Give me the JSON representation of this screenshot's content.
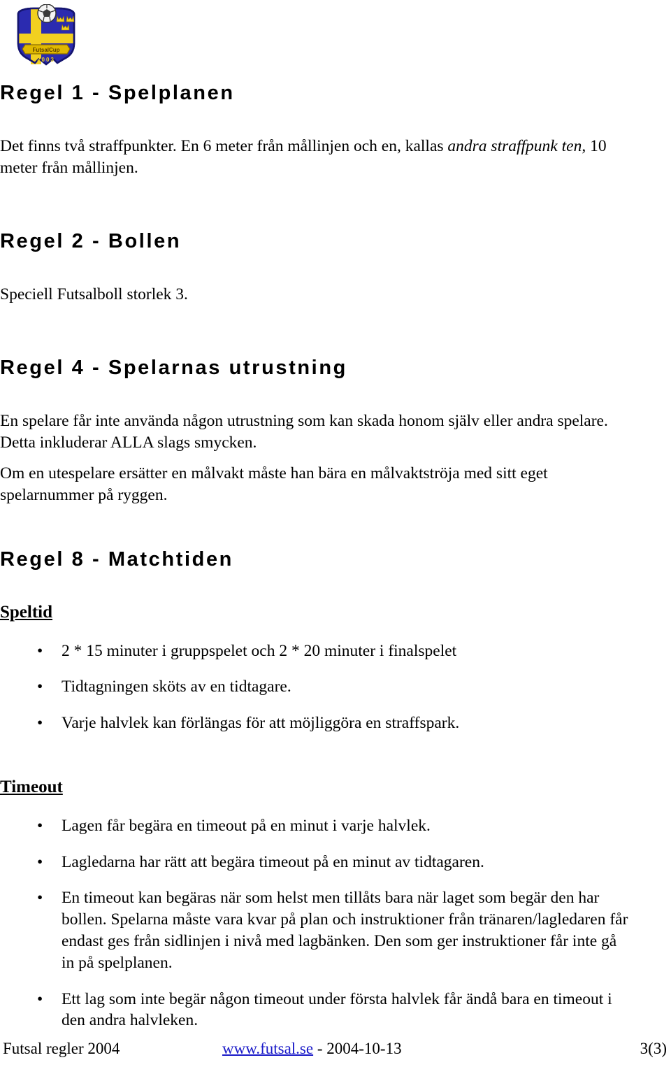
{
  "logo": {
    "name": "futsal-cup-shield-logo",
    "alt_text": "Futsal Cup 2003 shield emblem",
    "banner_text": "FutsalCup",
    "year_text": "2003",
    "colors": {
      "shield_blue": "#2b2bb0",
      "flag_yellow": "#f2d020",
      "outline_dark": "#1b1b6b",
      "ball_white": "#f2f2f2",
      "ball_dark": "#3a3a3a"
    }
  },
  "sections": [
    {
      "heading": "Regel 1 - Spelplanen",
      "paragraphs": [
        {
          "before": "Det finns två straffpunkter. En 6 meter från mållinjen och en, kallas ",
          "italic": "andra straffpunk ten",
          "after": ", 10 meter från mållinjen."
        }
      ]
    },
    {
      "heading": "Regel 2 - Bollen",
      "paragraphs": [
        {
          "text": "Speciell Futsalboll storlek 3."
        }
      ]
    },
    {
      "heading": "Regel 4 - Spelarnas utrustning",
      "paragraphs": [
        {
          "text": "En spelare får inte använda någon utrustning som kan skada honom själv eller andra spelare. Detta inkluderar ALLA slags smycken."
        },
        {
          "text": "Om en utespelare ersätter en målvakt måste han bära en målvaktströja med sitt eget spelarnummer på ryggen."
        }
      ]
    },
    {
      "heading": "Regel 8 - Matchtiden",
      "subsections": [
        {
          "title": "Speltid",
          "bullets": [
            "2 * 15 minuter i gruppspelet och 2 * 20 minuter i finalspelet",
            "Tidtagningen sköts av en tidtagare.",
            "Varje halvlek kan förlängas för att möjliggöra en straffspark."
          ]
        },
        {
          "title": "Timeout",
          "bullets": [
            "Lagen får begära en timeout på en minut i varje halvlek.",
            "Lagledarna har rätt att begära timeout på en minut av tidtagaren.",
            "En timeout kan begäras när som helst men tillåts bara när laget som begär den har bollen. Spelarna måste vara kvar på plan och instruktioner från tränaren/lagledaren får endast ges från sidlinjen i nivå med lagbänken. Den som ger instruktioner får inte gå in på spelplanen.",
            "Ett lag som inte begär någon timeout under första halvlek får ändå bara en timeout i den andra halvleken."
          ]
        }
      ]
    }
  ],
  "bullet_glyph": "•",
  "footer": {
    "left": "Futsal regler 2004",
    "link_text": "www.futsal.se",
    "date_text": " - 2004-10-13",
    "page_number": "3(3)",
    "link_color": "#1a1ac8"
  }
}
